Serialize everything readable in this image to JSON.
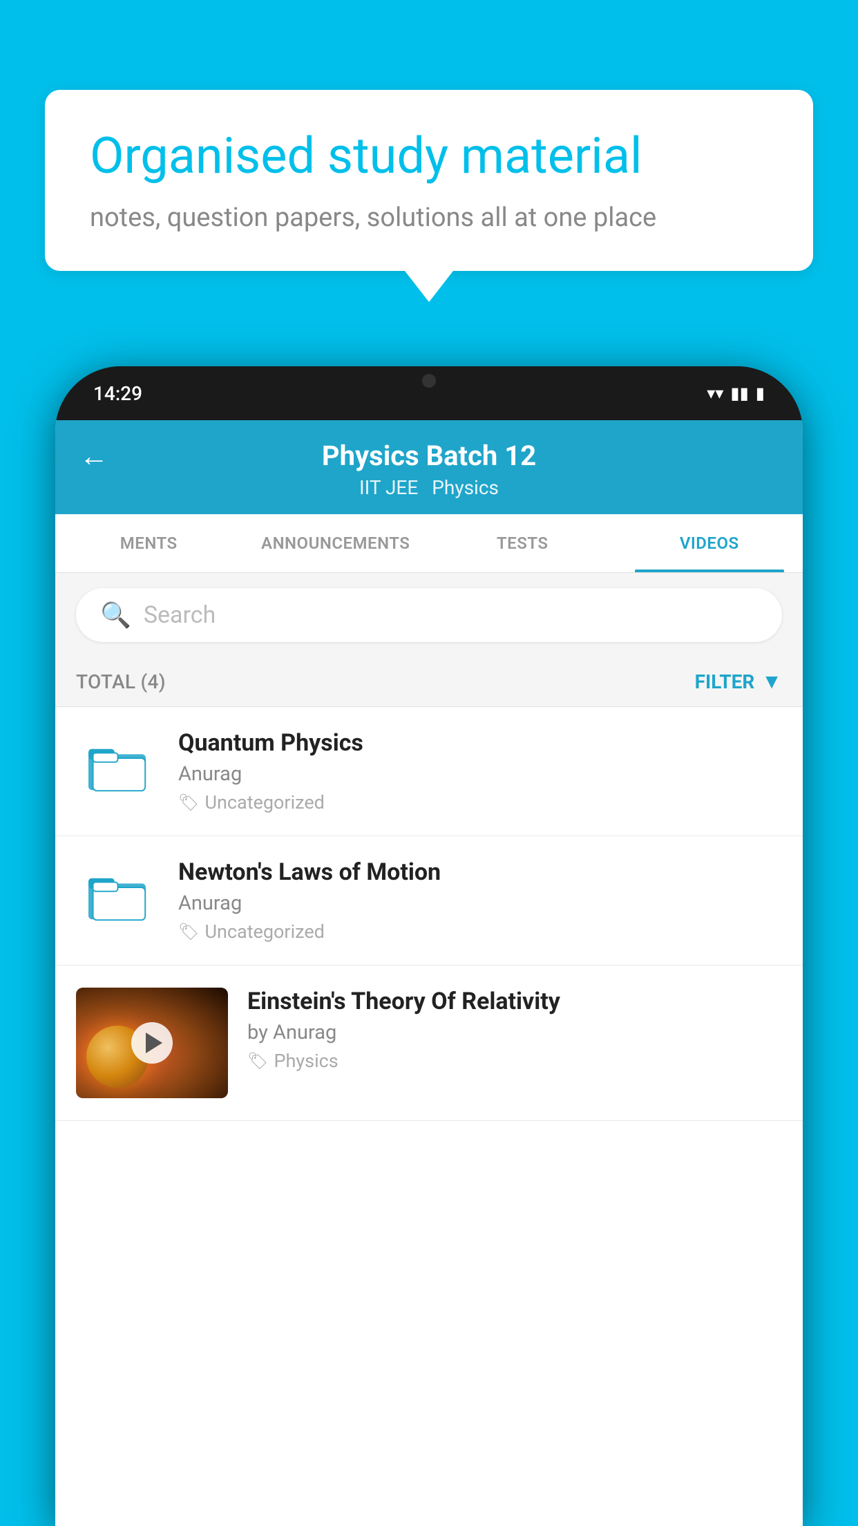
{
  "background_color": "#00BFEA",
  "speech_bubble": {
    "title": "Organised study material",
    "subtitle": "notes, question papers, solutions all at one place"
  },
  "phone": {
    "status_bar": {
      "time": "14:29"
    },
    "header": {
      "title": "Physics Batch 12",
      "subtitle1": "IIT JEE",
      "subtitle2": "Physics"
    },
    "tabs": [
      {
        "label": "MENTS",
        "active": false
      },
      {
        "label": "ANNOUNCEMENTS",
        "active": false
      },
      {
        "label": "TESTS",
        "active": false
      },
      {
        "label": "VIDEOS",
        "active": true
      }
    ],
    "search": {
      "placeholder": "Search"
    },
    "filter_bar": {
      "total_label": "TOTAL (4)",
      "filter_label": "FILTER"
    },
    "videos": [
      {
        "id": 1,
        "title": "Quantum Physics",
        "author": "Anurag",
        "tag": "Uncategorized",
        "type": "folder"
      },
      {
        "id": 2,
        "title": "Newton's Laws of Motion",
        "author": "Anurag",
        "tag": "Uncategorized",
        "type": "folder"
      },
      {
        "id": 3,
        "title": "Einstein's Theory Of Relativity",
        "author": "by Anurag",
        "tag": "Physics",
        "type": "video"
      }
    ]
  }
}
